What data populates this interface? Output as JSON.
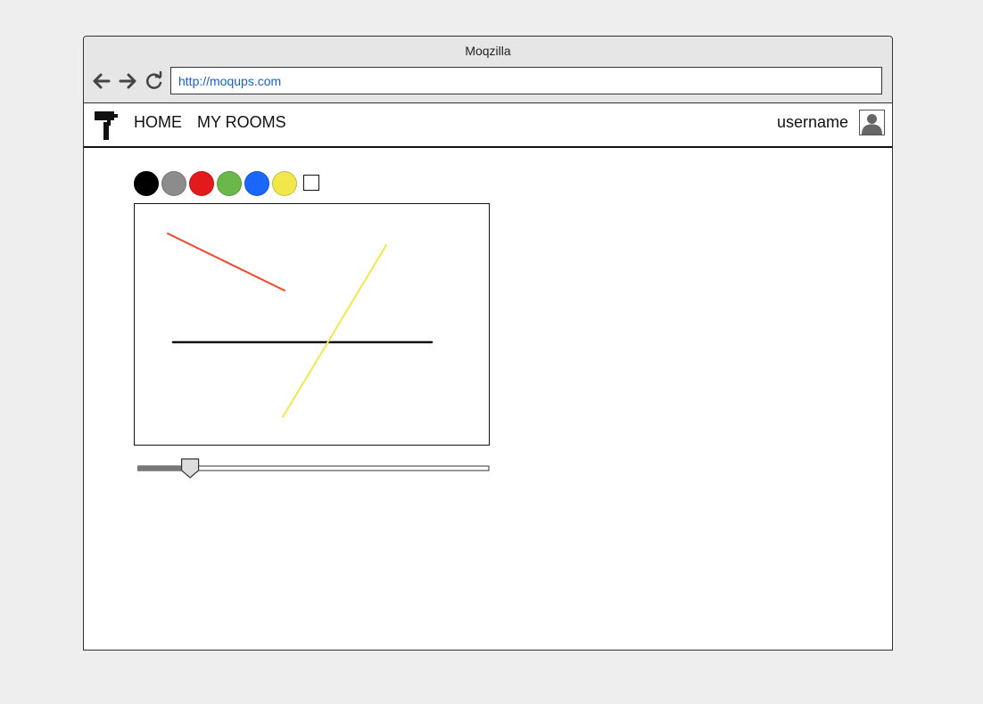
{
  "browser": {
    "title": "Moqzilla",
    "url": "http://moqups.com"
  },
  "nav": {
    "home": "HOME",
    "rooms": "MY ROOMS",
    "username": "username"
  },
  "palette": {
    "colors": [
      "#000000",
      "#8c8c8c",
      "#e31a1c",
      "#6ab84a",
      "#1a66ff",
      "#f0e84a"
    ],
    "empty_color": "none"
  },
  "strokes": [
    {
      "color": "#f0462a",
      "width": 2
    },
    {
      "color": "#111111",
      "width": 2.5
    },
    {
      "color": "#f0e84a",
      "width": 2
    }
  ],
  "brush": {
    "size_fraction": 0.15
  },
  "icons": {
    "back": "arrow-left-icon",
    "forward": "arrow-right-icon",
    "reload": "reload-icon",
    "logo": "paint-roller-icon",
    "avatar": "user-icon"
  }
}
